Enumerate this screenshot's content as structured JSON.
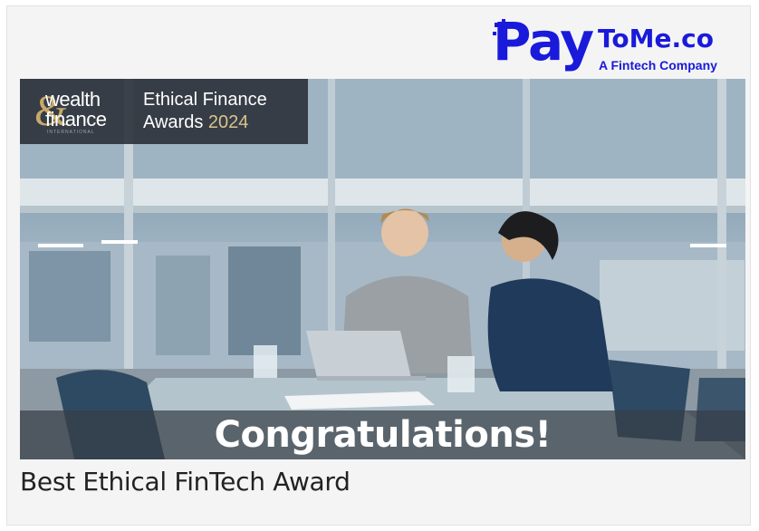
{
  "logo": {
    "brand_left": "Pay",
    "brand_right": "ToMe.co",
    "tagline": "A Fintech Company",
    "color": "#1a1adb"
  },
  "badge": {
    "logo_word_1": "wealth",
    "logo_word_2": "finance",
    "logo_amp": "&",
    "logo_sub": "INTERNATIONAL",
    "title_line_1": "Ethical Finance",
    "title_line_2": "Awards",
    "year": "2024",
    "accent": "#d9c38e"
  },
  "banner": {
    "text": "Congratulations!"
  },
  "caption": {
    "text": "Best Ethical FinTech Award"
  }
}
